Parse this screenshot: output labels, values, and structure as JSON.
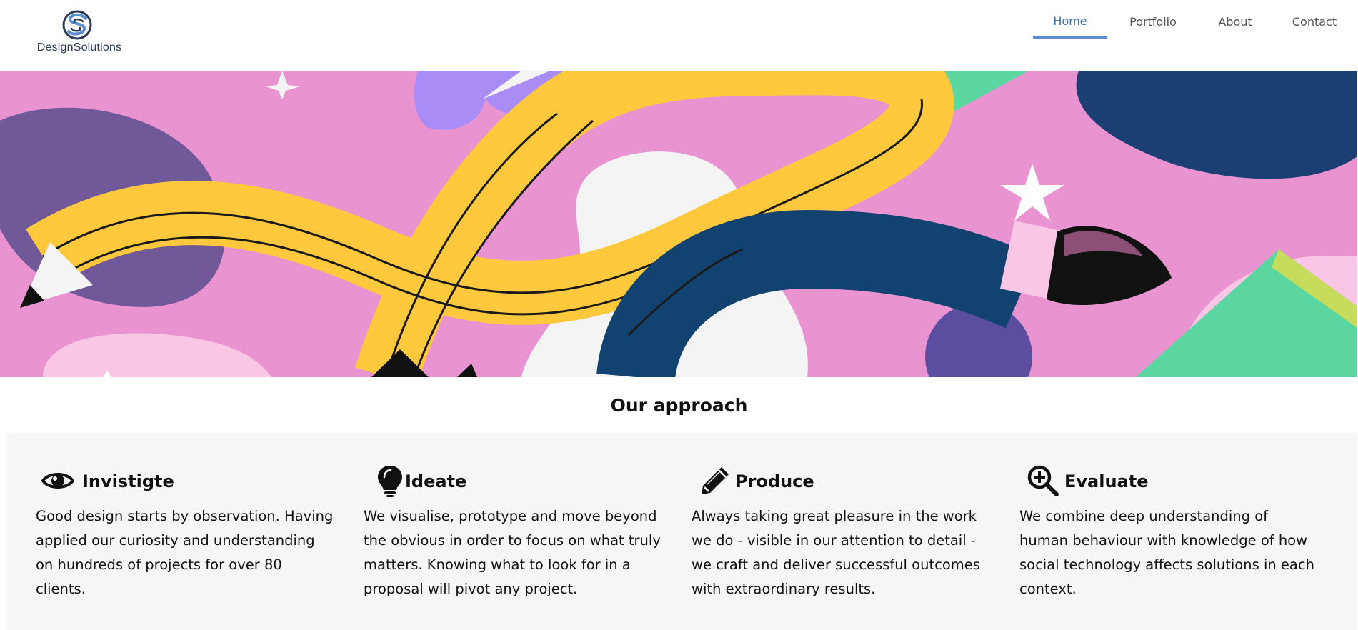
{
  "brand": {
    "name": "DesignSolutions",
    "accent": "#5b8fcf",
    "logo_icon": "interlocked-s-logo-icon"
  },
  "nav": {
    "items": [
      {
        "label": "Home",
        "active": true
      },
      {
        "label": "Portfolio",
        "active": false
      },
      {
        "label": "About",
        "active": false
      },
      {
        "label": "Contact",
        "active": false
      }
    ]
  },
  "hero": {
    "description_icon": "pencil-and-brush-illustration",
    "colors": {
      "background": "#e994d1",
      "pencil": "#ffc83d",
      "brush": "#12426f",
      "accent_green": "#5cd6a0",
      "accent_purple": "#a98cf6"
    }
  },
  "approach": {
    "title": "Our approach",
    "cards": [
      {
        "icon": "eye-icon",
        "title": "Invistigte",
        "text": "Good design starts by observation. Having applied our curiosity and understanding on hundreds of projects for over 80 clients."
      },
      {
        "icon": "lightbulb-icon",
        "title": "Ideate",
        "text": "We visualise, prototype and move beyond the obvious in order to focus on what truly matters. Knowing what to look for in a proposal will pivot any project."
      },
      {
        "icon": "pencil-icon",
        "title": "Produce",
        "text": "Always taking great pleasure in the work we do - visible in our attention to detail - we craft and deliver successful outcomes with extraordinary results."
      },
      {
        "icon": "zoom-in-icon",
        "title": "Evaluate",
        "text": "We combine deep understanding of human behaviour with knowledge of how social technology affects solutions in each context."
      }
    ]
  }
}
